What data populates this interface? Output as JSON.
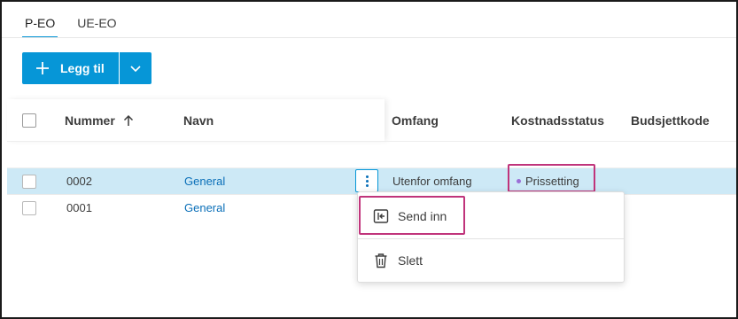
{
  "tabs": [
    {
      "label": "P-EO",
      "active": true
    },
    {
      "label": "UE-EO",
      "active": false
    }
  ],
  "toolbar": {
    "add_label": "Legg til",
    "accent_color": "#0696d7"
  },
  "table": {
    "columns": [
      "Nummer",
      "Navn",
      "Omfang",
      "Kostnadsstatus",
      "Budsjettkode"
    ],
    "sort": {
      "column": "Nummer",
      "direction": "ascending"
    },
    "rows": [
      {
        "nummer": "0002",
        "navn": "General",
        "omfang": "Utenfor omfang",
        "kostnadsstatus": "Prissetting",
        "budsjettkode": "",
        "selected": true
      },
      {
        "nummer": "0001",
        "navn": "General",
        "omfang": "",
        "kostnadsstatus": "",
        "budsjettkode": "",
        "selected": false
      }
    ]
  },
  "context_menu": {
    "items": [
      {
        "label": "Send inn",
        "icon": "send-in-icon"
      },
      {
        "label": "Slett",
        "icon": "trash-icon"
      }
    ]
  },
  "colors": {
    "highlight": "#c0347b",
    "selected_row": "#cde9f6",
    "link": "#0a6fb8",
    "status_dot": "#9b6fd6"
  }
}
